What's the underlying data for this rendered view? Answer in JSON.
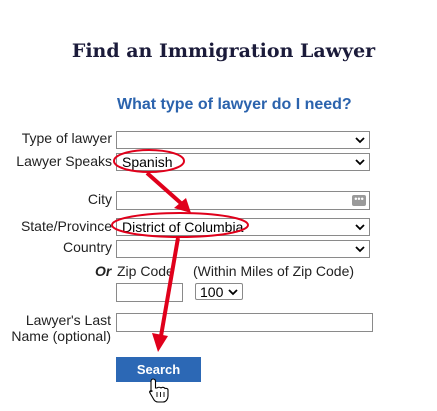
{
  "title": "Find an Immigration Lawyer",
  "subtitle": "What type of lawyer do I need?",
  "form": {
    "type_label": "Type of lawyer",
    "type_value": "",
    "speaks_label": "Lawyer Speaks",
    "speaks_value": "Spanish",
    "city_label": "City",
    "city_value": "",
    "city_button_glyph": "•••",
    "state_label": "State/Province",
    "state_value": "District of Columbia",
    "country_label": "Country",
    "country_value": "",
    "or_label": "Or",
    "zip_label": "Zip Code",
    "miles_label": "(Within Miles of Zip Code)",
    "zip_value": "",
    "miles_value": "100",
    "lastname_label_line1": "Lawyer's Last",
    "lastname_label_line2": "Name (optional)",
    "lastname_value": "",
    "search_label": "Search"
  },
  "annotation": {
    "color": "#e0001b",
    "circled": [
      "Spanish",
      "District of Columbia"
    ]
  }
}
